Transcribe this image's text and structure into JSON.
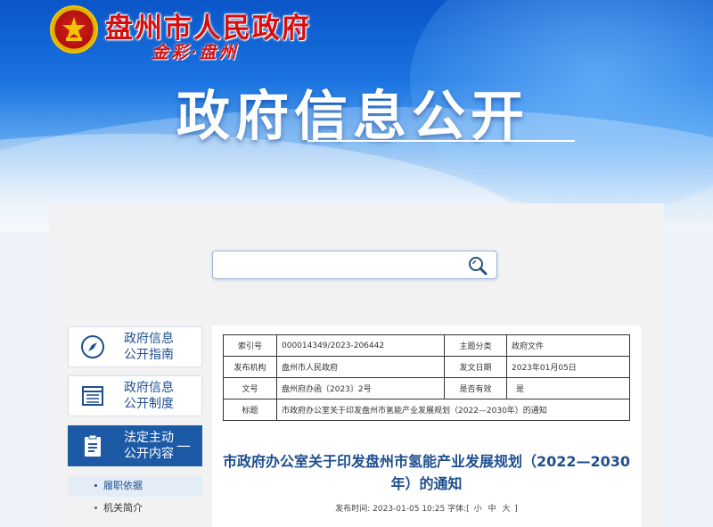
{
  "header": {
    "site_title": "盘州市人民政府",
    "slogan": "金彩·盘州",
    "page_heading": "政府信息公开"
  },
  "search": {
    "value": "",
    "placeholder": ""
  },
  "sidebar": {
    "items": [
      {
        "label": "政府信息\n公开指南",
        "icon": "compass-icon"
      },
      {
        "label": "政府信息\n公开制度",
        "icon": "document-list-icon"
      },
      {
        "label": "法定主动\n公开内容",
        "icon": "clipboard-icon",
        "toggle": "—"
      }
    ],
    "sub_items": [
      {
        "label": "履职依据"
      },
      {
        "label": "机关简介"
      }
    ]
  },
  "meta_table": {
    "rows": [
      {
        "k1": "索引号",
        "v1": "000014349/2023-206442",
        "k2": "主题分类",
        "v2": "政府文件"
      },
      {
        "k1": "发布机构",
        "v1": "盘州市人民政府",
        "k2": "发文日期",
        "v2": "2023年01月05日"
      },
      {
        "k1": "文号",
        "v1": "盘州府办函〔2023〕2号",
        "k2": "是否有效",
        "v2": "是"
      }
    ],
    "title_row": {
      "k": "标题",
      "v": "市政府办公室关于印发盘州市氢能产业发展规划（2022—2030年）的通知"
    }
  },
  "document": {
    "title": "市政府办公室关于印发盘州市氢能产业发展规划（2022—2030年）的通知",
    "pub_label": "发布时间:",
    "pub_time": "2023-01-05 10:25",
    "font_label": "字体:[",
    "font_small": "小",
    "font_medium": "中",
    "font_large": "大",
    "font_close": "]"
  },
  "colors": {
    "accent": "#1d5aa6",
    "title_red": "#d40f0f",
    "heading_blue": "#1e4f8f"
  }
}
